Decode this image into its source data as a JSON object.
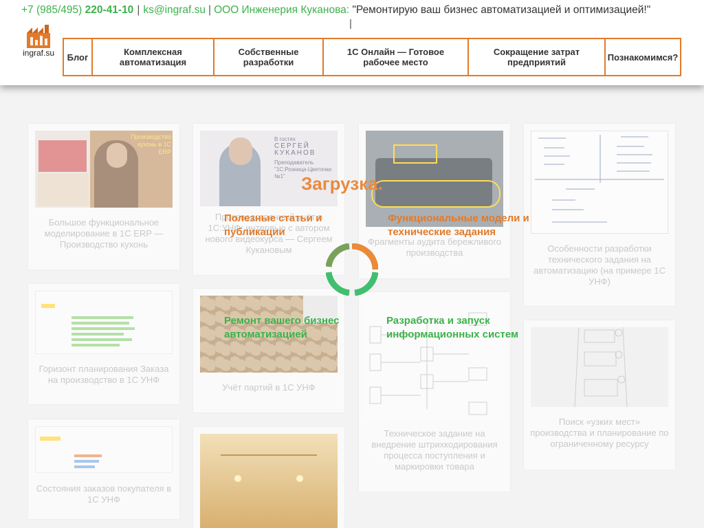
{
  "header": {
    "phone_prefix": "+7 (985/495) ",
    "phone_main": "220-41-10",
    "divider": "|",
    "email": "ks@ingraf.su",
    "company": "ООО Инженерия Куканова",
    "tagline": "\"Ремонтирую ваш бизнес автоматизацией и оптимизацией!\"",
    "caret": "|",
    "logo_text": "ingraf.su"
  },
  "nav": [
    {
      "label": "Блог"
    },
    {
      "label": "Комплексная автоматизация"
    },
    {
      "label": "Собственные разработки"
    },
    {
      "label": "1С Онлайн — Готовое рабочее место"
    },
    {
      "label": "Сокращение затрат предприятий"
    },
    {
      "label": "Познакомимся?"
    }
  ],
  "cards": [
    {
      "title": "Большое функциональное моделирование в 1С ERP — Производство кухонь",
      "thumb_caption": "Производство кухонь в 1С ERP"
    },
    {
      "title": "Производственный учёт в 1С:УНФ: интервью с автором нового видеокурса — Сергеем Кукановым",
      "thumb_lines": [
        "В гостях",
        "СЕРГЕЙ",
        "КУКАНОВ",
        "Преподаватель",
        "\"1С:Розница-Цветочки №1\""
      ]
    },
    {
      "title": "Фрагменты аудита бережливого производства"
    },
    {
      "title": "Особенности разработки технического задания на автоматизацию (на примере 1С УНФ)"
    },
    {
      "title": "Горизонт планирования Заказа на производство в 1С УНФ"
    },
    {
      "title": "Учёт партий в 1С УНФ"
    },
    {
      "title": "Техническое задание на внедрение штрихкодирования процесса поступления и маркировки товара"
    },
    {
      "title": "Поиск «узких мест» производства и планирование по ограниченному ресурсу"
    },
    {
      "title": "Состояния заказов покупателя в 1С УНФ"
    },
    {
      "title": ""
    }
  ],
  "overlay": {
    "loading": "Загрузка.",
    "labels": [
      {
        "text": "Полезные статьи и публикации",
        "color": "#e07b2c"
      },
      {
        "text": "Функциональные модели и технические задания",
        "color": "#e07b2c"
      },
      {
        "text": "Ремонт вашего бизнес автоматизацией",
        "color": "#3bb24a"
      },
      {
        "text": "Разработка и запуск информационных систем",
        "color": "#3bb24a"
      }
    ]
  },
  "colors": {
    "accent_orange": "#e07b2c",
    "accent_green": "#3bb24a"
  }
}
